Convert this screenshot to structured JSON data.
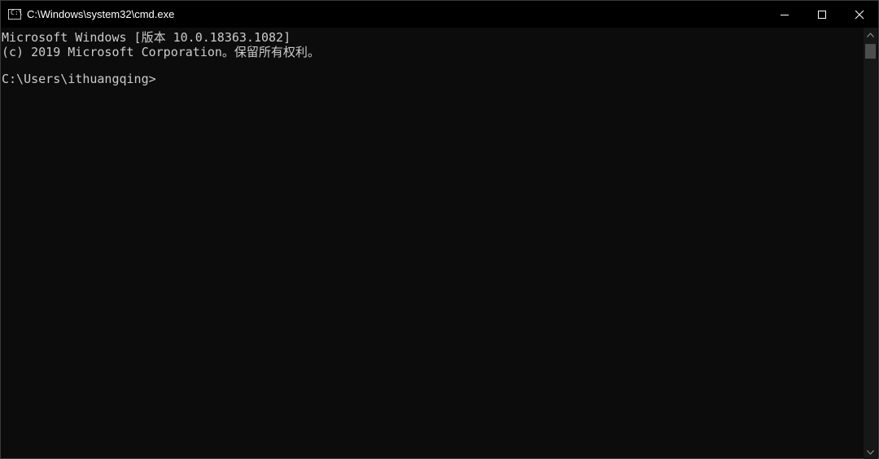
{
  "window": {
    "title": "C:\\Windows\\system32\\cmd.exe",
    "app_icon": "cmd-icon",
    "app_icon_glyph": "C:\\",
    "controls": [
      "minimize-icon",
      "maximize-icon",
      "close-icon"
    ]
  },
  "console": {
    "lines": [
      "Microsoft Windows [版本 10.0.18363.1082]",
      "(c) 2019 Microsoft Corporation。保留所有权利。",
      "",
      "C:\\Users\\ithuangqing>"
    ],
    "text_color": "#cccccc",
    "background": "#0c0c0c"
  },
  "scrollbar": {
    "up_icon": "scroll-up-icon",
    "down_icon": "scroll-down-icon"
  }
}
